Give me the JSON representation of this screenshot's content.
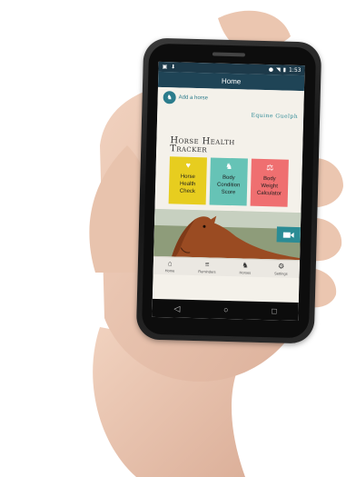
{
  "status_bar": {
    "time": "1:53"
  },
  "app_bar": {
    "title": "Home"
  },
  "add_horse": {
    "label": "Add a horse"
  },
  "brand": {
    "label": "Equine Guelph"
  },
  "title": {
    "line1": "Horse Health",
    "line2": "Tracker"
  },
  "tiles": [
    {
      "label_1": "Horse",
      "label_2": "Health",
      "label_3": "Check",
      "color": "#e7cd1f",
      "icon": "heart-icon"
    },
    {
      "label_1": "Body",
      "label_2": "Condition",
      "label_3": "Score",
      "color": "#66c3b6",
      "icon": "horse-icon"
    },
    {
      "label_1": "Body",
      "label_2": "Weight",
      "label_3": "Calculator",
      "color": "#ef6f70",
      "icon": "scale-icon"
    }
  ],
  "bottom_nav": [
    {
      "label": "Home",
      "icon": "home-icon"
    },
    {
      "label": "Reminders",
      "icon": "reminders-icon"
    },
    {
      "label": "Horses",
      "icon": "horse-icon"
    },
    {
      "label": "Settings",
      "icon": "settings-icon"
    }
  ],
  "colors": {
    "app_bar": "#1f4456",
    "accent": "#2b7c8c"
  }
}
